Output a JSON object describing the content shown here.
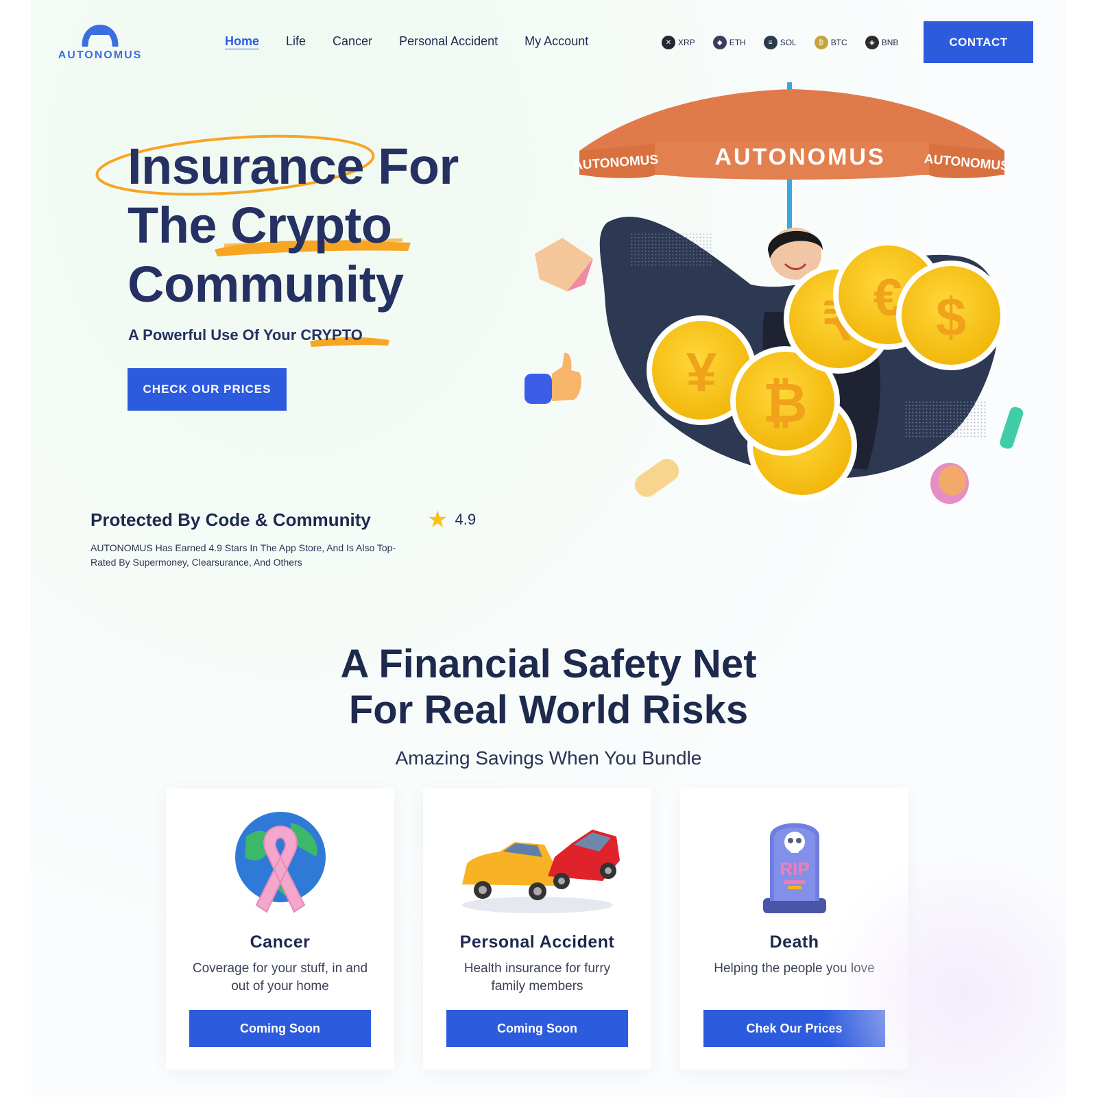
{
  "brand": {
    "name": "AUTONOMUS"
  },
  "nav": {
    "items": [
      {
        "label": "Home",
        "active": true
      },
      {
        "label": "Life"
      },
      {
        "label": "Cancer"
      },
      {
        "label": "Personal Accident"
      },
      {
        "label": "My Account"
      }
    ]
  },
  "crypto": {
    "items": [
      {
        "symbol": "XRP",
        "color": "#23292f"
      },
      {
        "symbol": "ETH",
        "color": "#3c3c5d"
      },
      {
        "symbol": "SOL",
        "color": "#2b3a4a"
      },
      {
        "symbol": "BTC",
        "color": "#c9a23a"
      },
      {
        "symbol": "BNB",
        "color": "#2b2b2b"
      }
    ]
  },
  "header": {
    "contact_label": "CONTACT"
  },
  "hero": {
    "title_line1": "Insurance For",
    "title_line2": "The Crypto",
    "title_line3": "Community",
    "subtitle_prefix": "A Powerful Use Of Your ",
    "subtitle_highlight": "CRYPTO",
    "cta_label": "CHECK OUR PRICES",
    "umbrella_text": "AUTONOMUS",
    "umbrella_side_text": "AUTONOMUS"
  },
  "trust": {
    "title": "Protected By Code & Community",
    "rating": "4.9",
    "description": "AUTONOMUS Has Earned 4.9 Stars In The App Store, And Is Also Top-Rated By Supermoney, Clearsurance, And Others"
  },
  "section": {
    "title_line1": "A Financial Safety Net",
    "title_line2": "For Real World Risks",
    "subtitle": "Amazing Savings When You Bundle"
  },
  "cards": [
    {
      "title": "Cancer",
      "desc": "Coverage for your stuff, in and out of your home",
      "button": "Coming Soon",
      "icon": "cancer-ribbon-globe-icon"
    },
    {
      "title": "Personal Accident",
      "desc": "Health insurance for furry family members",
      "button": "Coming Soon",
      "icon": "car-crash-icon"
    },
    {
      "title": "Death",
      "desc": "Helping the people you love",
      "button": "Chek Our Prices",
      "icon": "rip-tombstone-icon"
    }
  ],
  "colors": {
    "primary": "#2d5bde",
    "navy": "#1d2a4d",
    "accent_orange": "#f7a524",
    "umbrella": "#e07a4a",
    "coin_gold": "#f7c21a"
  }
}
